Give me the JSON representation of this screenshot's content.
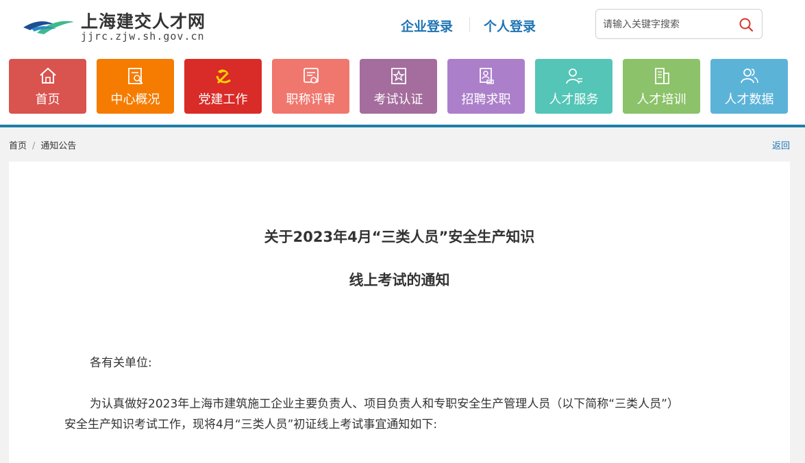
{
  "site": {
    "name": "上海建交人才网",
    "url": "jjrc.zjw.sh.gov.cn"
  },
  "header": {
    "company_login": "企业登录",
    "personal_login": "个人登录",
    "search_placeholder": "请输入关键字搜索"
  },
  "nav": [
    {
      "label": "首页",
      "icon": "home-icon",
      "color": "#d9534f"
    },
    {
      "label": "中心概况",
      "icon": "overview-icon",
      "color": "#f57c00"
    },
    {
      "label": "党建工作",
      "icon": "party-emblem-icon",
      "color": "#d92b27"
    },
    {
      "label": "职称评审",
      "icon": "certificate-icon",
      "color": "#f0776e"
    },
    {
      "label": "考试认证",
      "icon": "exam-badge-icon",
      "color": "#a46d9d"
    },
    {
      "label": "招聘求职",
      "icon": "resume-icon",
      "color": "#ab7fca"
    },
    {
      "label": "人才服务",
      "icon": "user-service-icon",
      "color": "#54c5b6"
    },
    {
      "label": "人才培训",
      "icon": "building-icon",
      "color": "#8cc26a"
    },
    {
      "label": "人才数据",
      "icon": "users-icon",
      "color": "#5cb3d8"
    }
  ],
  "breadcrumb": {
    "home": "首页",
    "separator": "/",
    "current": "通知公告",
    "back": "返回"
  },
  "article": {
    "title_line1": "关于2023年4月“三类人员”安全生产知识",
    "title_line2": "线上考试的通知",
    "salutation": "各有关单位:",
    "para1_line1": "为认真做好2023年上海市建筑施工企业主要负责人、项目负责人和专职安全生产管理人员（以下简称“三类人员”）",
    "para1_line2": "安全生产知识考试工作，现将4月“三类人员”初证线上考试事宜通知如下:"
  },
  "colors": {
    "accent_blue": "#1e73b4",
    "divider_line": "#1d7fa8"
  }
}
